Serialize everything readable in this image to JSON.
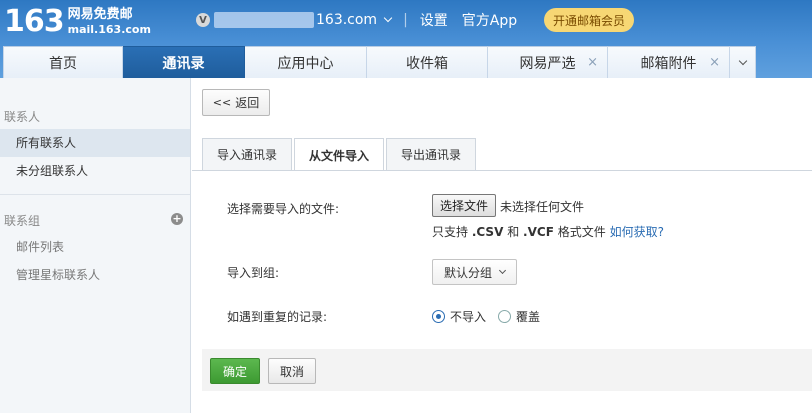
{
  "header": {
    "logo_number": "163",
    "logo_name": "网易免费邮",
    "logo_domain": "mail.163.com",
    "account_badge": "V",
    "account_domain": "163.com",
    "settings": "设置",
    "app": "官方App",
    "vip": "开通邮箱会员"
  },
  "tabs": [
    {
      "label": "首页"
    },
    {
      "label": "通讯录"
    },
    {
      "label": "应用中心"
    },
    {
      "label": "收件箱"
    },
    {
      "label": "网易严选",
      "close": "×"
    },
    {
      "label": "邮箱附件",
      "close": "×"
    }
  ],
  "sidebar": {
    "contacts_header": "联系人",
    "all_contacts": "所有联系人",
    "ungrouped": "未分组联系人",
    "groups_header": "联系组",
    "plus": "+",
    "mail_list": "邮件列表",
    "manage_starred": "管理星标联系人"
  },
  "main": {
    "back": "返回",
    "back_chevron": "<<",
    "subtabs": [
      "导入通讯录",
      "从文件导入",
      "导出通讯录"
    ],
    "file_label": "选择需要导入的文件:",
    "file_button": "选择文件",
    "file_status": "未选择任何文件",
    "support_prefix": "只支持",
    "support_csv": ".CSV",
    "support_and": "和",
    "support_vcf": ".VCF",
    "support_suffix": "格式文件",
    "support_link": "如何获取?",
    "group_label": "导入到组:",
    "group_value": "默认分组",
    "dup_label": "如遇到重复的记录:",
    "dup_options": [
      "不导入",
      "覆盖"
    ],
    "dup_selected": 0,
    "ok": "确定",
    "cancel": "取消"
  },
  "colors": {
    "header_blue": "#3d86cf",
    "active_tab": "#1f5d9c",
    "vip_gold": "#f7d774",
    "ok_green": "#4aa83e",
    "link_blue": "#2a6cb3"
  }
}
